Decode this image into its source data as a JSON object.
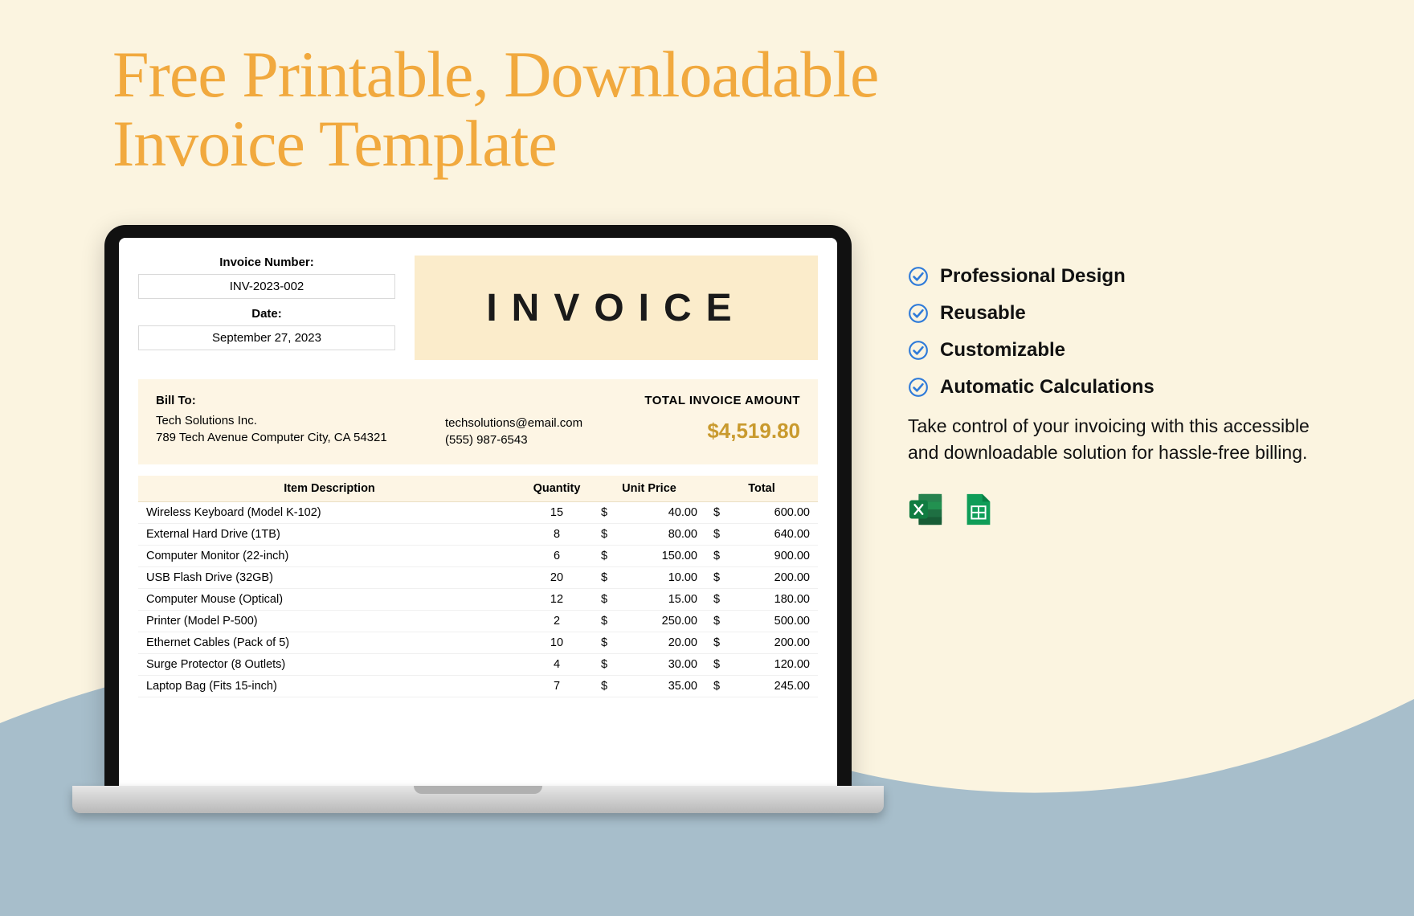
{
  "headline": "Free Printable, Downloadable\nInvoice Template",
  "invoice": {
    "meta": {
      "number_label": "Invoice Number:",
      "number_value": "INV-2023-002",
      "date_label": "Date:",
      "date_value": "September 27, 2023"
    },
    "title": "INVOICE",
    "billto": {
      "label": "Bill To:",
      "company": "Tech Solutions Inc.",
      "address": "789 Tech Avenue Computer City, CA 54321",
      "email": "techsolutions@email.com",
      "phone": "(555) 987-6543",
      "total_label": "TOTAL INVOICE AMOUNT",
      "total_amount": "$4,519.80"
    },
    "columns": {
      "desc": "Item Description",
      "qty": "Quantity",
      "unit": "Unit Price",
      "total": "Total"
    },
    "rows": [
      {
        "desc": "Wireless Keyboard (Model K-102)",
        "qty": "15",
        "unit": "40.00",
        "total": "600.00"
      },
      {
        "desc": "External Hard Drive (1TB)",
        "qty": "8",
        "unit": "80.00",
        "total": "640.00"
      },
      {
        "desc": "Computer Monitor (22-inch)",
        "qty": "6",
        "unit": "150.00",
        "total": "900.00"
      },
      {
        "desc": "USB Flash Drive (32GB)",
        "qty": "20",
        "unit": "10.00",
        "total": "200.00"
      },
      {
        "desc": "Computer Mouse (Optical)",
        "qty": "12",
        "unit": "15.00",
        "total": "180.00"
      },
      {
        "desc": "Printer (Model P-500)",
        "qty": "2",
        "unit": "250.00",
        "total": "500.00"
      },
      {
        "desc": "Ethernet Cables (Pack of 5)",
        "qty": "10",
        "unit": "20.00",
        "total": "200.00"
      },
      {
        "desc": "Surge Protector (8 Outlets)",
        "qty": "4",
        "unit": "30.00",
        "total": "120.00"
      },
      {
        "desc": "Laptop Bag (Fits 15-inch)",
        "qty": "7",
        "unit": "35.00",
        "total": "245.00"
      }
    ],
    "currency": "$"
  },
  "features": [
    "Professional Design",
    "Reusable",
    "Customizable",
    "Automatic Calculations"
  ],
  "blurb": "Take control of your invoicing with this accessible and downloadable solution for hassle-free billing.",
  "badges": {
    "excel": "excel-icon",
    "sheets": "sheets-icon"
  },
  "colors": {
    "accent": "#f1a93e",
    "wave": "#a7becb",
    "cream": "#fbeccb",
    "total": "#c99a2e",
    "check": "#2f7bd9"
  }
}
